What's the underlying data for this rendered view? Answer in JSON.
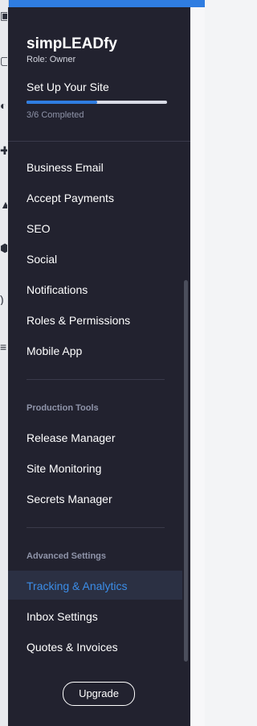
{
  "site": {
    "name": "simpLEADfy",
    "role": "Role: Owner"
  },
  "setup": {
    "title": "Set Up Your Site",
    "progress_completed": 3,
    "progress_total": 6,
    "completed_text": "3/6 Completed"
  },
  "menu": {
    "general": [
      "Business Email",
      "Accept Payments",
      "SEO",
      "Social",
      "Notifications",
      "Roles & Permissions",
      "Mobile App"
    ],
    "production_header": "Production Tools",
    "production": [
      "Release Manager",
      "Site Monitoring",
      "Secrets Manager"
    ],
    "advanced_header": "Advanced Settings",
    "advanced": [
      "Tracking & Analytics",
      "Inbox Settings",
      "Quotes & Invoices"
    ],
    "active": "Tracking & Analytics"
  },
  "upgrade_label": "Upgrade",
  "colors": {
    "panel_bg": "#22222f",
    "accent": "#2f7de1",
    "active_bg": "#2b3043",
    "section_text": "#8f94a9"
  }
}
